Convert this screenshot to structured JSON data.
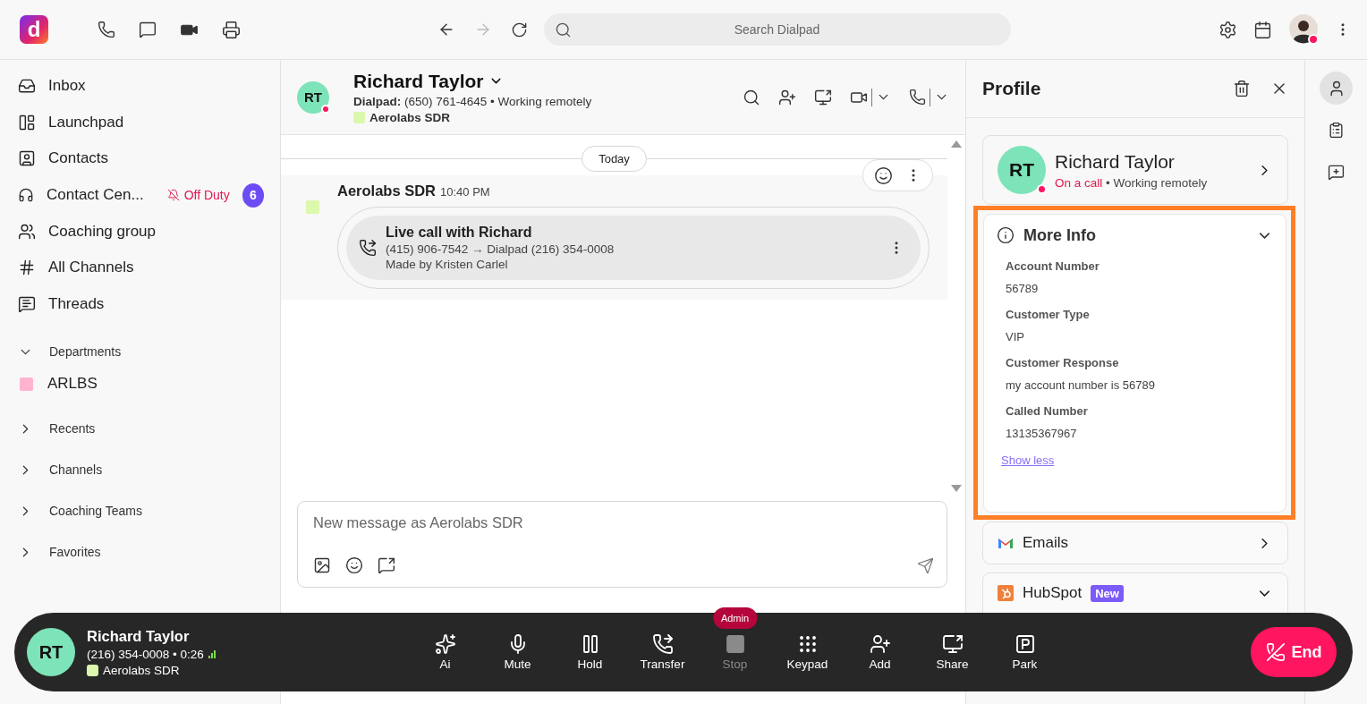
{
  "app": {
    "logo": "d"
  },
  "top_bar": {
    "search": {
      "placeholder": "Search Dialpad"
    }
  },
  "sidebar": {
    "items": [
      {
        "kind": "inbox",
        "label": "Inbox",
        "selected": false
      },
      {
        "kind": "launchpad",
        "label": "Launchpad",
        "selected": false
      },
      {
        "kind": "contacts",
        "label": "Contacts",
        "selected": false
      },
      {
        "kind": "contact_center",
        "label": "Contact Cen...",
        "status": "Off Duty",
        "badge": "6",
        "selected": false
      },
      {
        "kind": "group",
        "label": "Coaching group",
        "selected": false
      },
      {
        "kind": "channels",
        "label": "All Channels",
        "selected": false
      },
      {
        "kind": "threads",
        "label": "Threads",
        "selected": false
      }
    ],
    "sections": [
      {
        "label": "Departments",
        "expanded": true,
        "children": [
          {
            "label": "ARLBS",
            "color": "#ffb3d1"
          }
        ]
      },
      {
        "label": "Recents",
        "expanded": false
      },
      {
        "label": "Channels",
        "expanded": false
      },
      {
        "label": "Coaching Teams",
        "expanded": false
      },
      {
        "label": "Favorites",
        "expanded": false
      }
    ]
  },
  "conversation": {
    "header": {
      "initials": "RT",
      "name": "Richard Taylor",
      "line_label": "Dialpad:",
      "line": "(650) 761-4645 • Working remotely",
      "department": "Aerolabs SDR"
    },
    "date_divider": "Today",
    "message": {
      "sender": "Aerolabs SDR",
      "time": "10:40 PM",
      "call": {
        "title": "Live call with Richard",
        "route": "(415) 906-7542 → Dialpad (216) 354-0008",
        "made_by": "Made by Kristen Carlel"
      }
    },
    "composer": {
      "placeholder": "New message as Aerolabs SDR"
    }
  },
  "profile": {
    "title": "Profile",
    "contact": {
      "initials": "RT",
      "name": "Richard Taylor",
      "call_status": "On a call",
      "status": "• Working remotely"
    },
    "more_info": {
      "title": "More Info",
      "expanded": true,
      "fields": [
        {
          "label": "Account Number",
          "value": "56789"
        },
        {
          "label": "Customer Type",
          "value": "VIP"
        },
        {
          "label": "Customer Response",
          "value": "my account number is 56789"
        },
        {
          "label": "Called Number",
          "value": "13135367967"
        }
      ],
      "link": "Show less"
    },
    "integrations": [
      {
        "kind": "gmail",
        "name": "Emails",
        "expanded": false
      },
      {
        "kind": "hubspot",
        "name": "HubSpot",
        "badge": "New",
        "expanded": true
      }
    ]
  },
  "call_bar": {
    "initials": "RT",
    "name": "Richard Taylor",
    "number": "(216) 354-0008 • 0:26",
    "department": "Aerolabs SDR",
    "controls": [
      {
        "kind": "ai",
        "label": "Ai",
        "disabled": false
      },
      {
        "kind": "mute",
        "label": "Mute",
        "disabled": false
      },
      {
        "kind": "hold",
        "label": "Hold",
        "disabled": false
      },
      {
        "kind": "transfer",
        "label": "Transfer",
        "disabled": false
      },
      {
        "kind": "stop",
        "label": "Stop",
        "disabled": true,
        "tag": "Admin"
      },
      {
        "kind": "keypad",
        "label": "Keypad",
        "disabled": false
      },
      {
        "kind": "add",
        "label": "Add",
        "disabled": false
      },
      {
        "kind": "share",
        "label": "Share",
        "disabled": false
      },
      {
        "kind": "park",
        "label": "Park",
        "disabled": false
      }
    ],
    "end": "End"
  }
}
